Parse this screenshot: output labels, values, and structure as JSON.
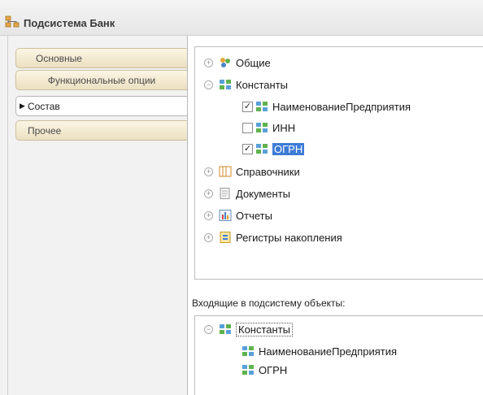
{
  "window": {
    "title": "Подсистема Банк"
  },
  "tabs": [
    {
      "label": "Основные",
      "active": false
    },
    {
      "label": "Функциональные опции",
      "active": false
    },
    {
      "label": "Состав",
      "active": true
    },
    {
      "label": "Прочее",
      "active": false
    }
  ],
  "tree": {
    "general": "Общие",
    "constants": "Константы",
    "constant_items": [
      {
        "label": "НаименованиеПредприятия",
        "checked": true
      },
      {
        "label": "ИНН",
        "checked": false
      },
      {
        "label": "ОГРН",
        "checked": true,
        "selected": true
      }
    ],
    "catalogs": "Справочники",
    "documents": "Документы",
    "reports": "Отчеты",
    "registers": "Регистры накопления"
  },
  "included": {
    "label": "Входящие в подсистему объекты:",
    "constants": "Константы",
    "items": [
      "НаименованиеПредприятия",
      "ОГРН"
    ]
  },
  "symbols": {
    "expand": "+",
    "collapse": "−",
    "check": "✓",
    "arrow": "▶"
  }
}
